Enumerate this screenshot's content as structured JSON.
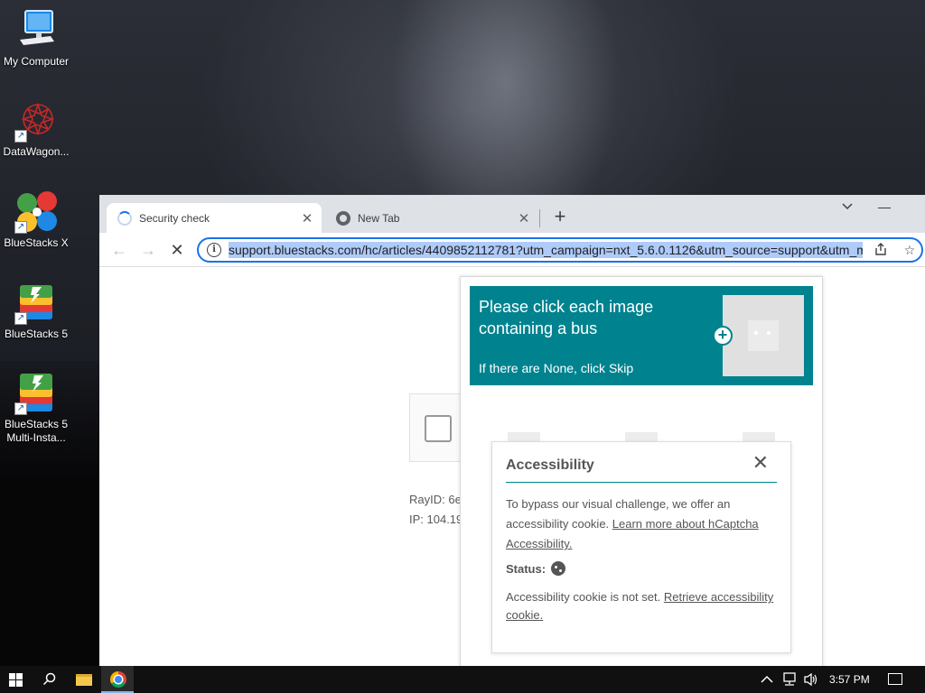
{
  "desktop": {
    "icons": [
      {
        "label": "My Computer"
      },
      {
        "label": "DataWagon..."
      },
      {
        "label": "BlueStacks X"
      },
      {
        "label": "BlueStacks 5"
      },
      {
        "label": "BlueStacks 5 Multi-Insta..."
      }
    ]
  },
  "browser": {
    "tabs": [
      {
        "title": "Security check",
        "icon": "loading-spinner-icon",
        "active": true
      },
      {
        "title": "New Tab",
        "icon": "chrome-icon",
        "active": false
      }
    ],
    "new_tab_symbol": "+",
    "url": "support.bluestacks.com/hc/articles/4409852112781?utm_campaign=nxt_5.6.0.1126&utm_source=support&utm_m"
  },
  "page": {
    "ray_id": "RayID: 6e",
    "ip": "IP: 104.19"
  },
  "hcaptcha": {
    "prompt": "Please click each image containing a bus",
    "subtext": "If there are None, click Skip",
    "accent_color": "#00838f",
    "accessibility": {
      "title": "Accessibility",
      "body_text": "To bypass our visual challenge, we offer an accessibility cookie.",
      "learn_more_link": "Learn more about hCaptcha Accessibility.",
      "status_label": "Status:",
      "not_set_text": "Accessibility cookie is not set.",
      "retrieve_link": "Retrieve accessibility cookie."
    }
  },
  "taskbar": {
    "time": "3:57 PM"
  }
}
